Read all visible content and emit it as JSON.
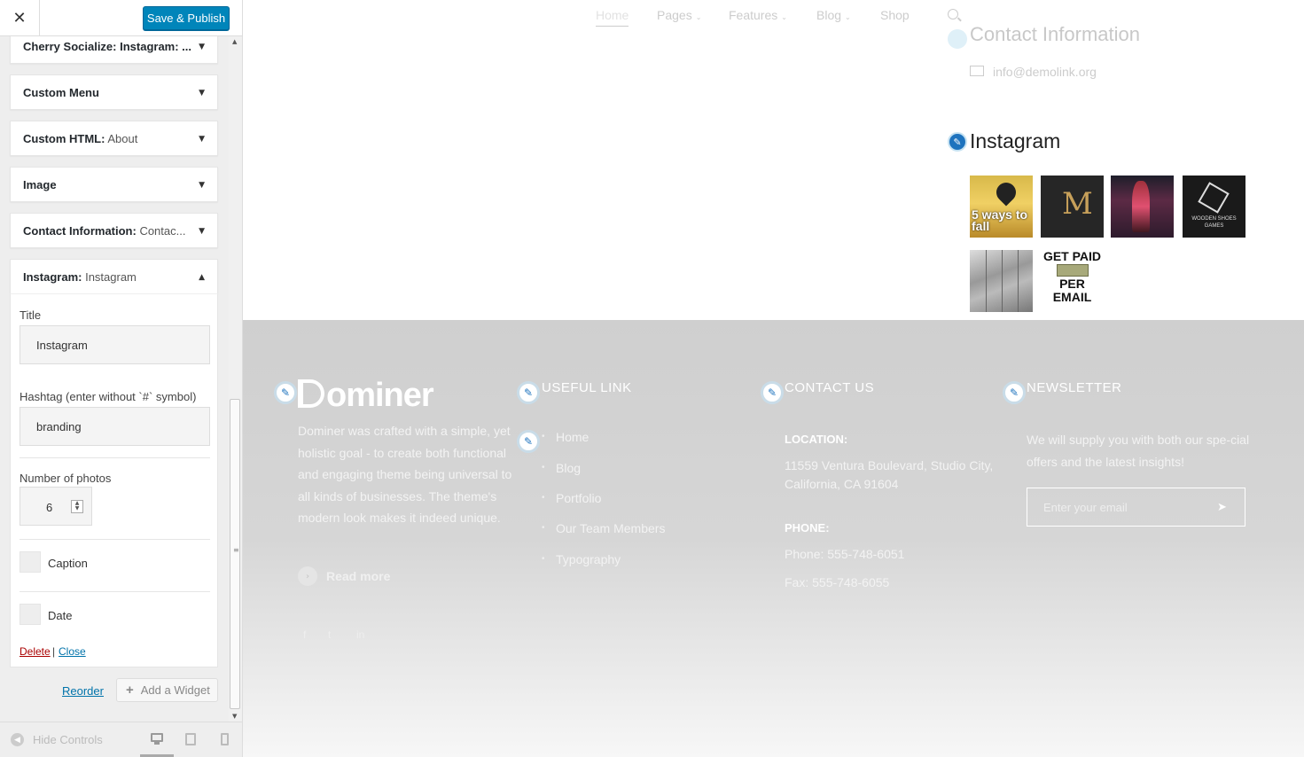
{
  "customizer": {
    "close_icon": "close-icon",
    "save_label": "Save & Publish",
    "widgets": [
      {
        "name": "Cherry Socialize: Instagram: ...",
        "sub": ""
      },
      {
        "name": "Custom Menu",
        "sub": ""
      },
      {
        "name": "Custom HTML:",
        "sub": " About"
      },
      {
        "name": "Image",
        "sub": ""
      },
      {
        "name": "Contact Information:",
        "sub": " Contac..."
      },
      {
        "name": "Instagram:",
        "sub": " Instagram"
      }
    ],
    "form": {
      "title_label": "Title",
      "title_value": "Instagram",
      "hashtag_label": "Hashtag (enter without `#` symbol)",
      "hashtag_value": "branding",
      "photos_label": "Number of photos",
      "photos_value": "6",
      "caption_label": "Caption",
      "date_label": "Date",
      "delete_label": "Delete",
      "separator": "|",
      "close_label": "Close"
    },
    "reorder_label": "Reorder",
    "add_widget_label": "Add a Widget",
    "hide_controls_label": "Hide Controls"
  },
  "preview": {
    "nav": {
      "home": "Home",
      "pages": "Pages",
      "features": "Features",
      "blog": "Blog",
      "shop": "Shop"
    },
    "contact_widget_title": "Contact Information",
    "contact_email": "info@demolink.org",
    "instagram_title": "Instagram",
    "photos": {
      "p1_text": "5 ways to fall",
      "p4_text": "WOODEN SHOES GAMES",
      "p6_top": "GET PAID",
      "p6_bottom": "PER EMAIL"
    },
    "footer": {
      "logo": "ominer",
      "about": "Dominer was crafted with a simple, yet holistic goal - to create both functional and engaging theme being universal to all kinds of businesses. The theme's modern look makes it indeed unique.",
      "read_more": "Read more",
      "useful_title": "USEFUL LINK",
      "links": [
        "Home",
        "Blog",
        "Portfolio",
        "Our Team Members",
        "Typography"
      ],
      "contact_title": "CONTACT US",
      "location_label": "LOCATION:",
      "location_value": "11559 Ventura Boulevard, Studio City, California, CA 91604",
      "phone_label": "PHONE:",
      "phone_value": "Phone: 555-748-6051",
      "fax_value": "Fax: 555-748-6055",
      "newsletter_title": "NEWSLETTER",
      "newsletter_text": "We will supply you with both our spe-cial offers and the latest insights!",
      "newsletter_placeholder": "Enter your email",
      "social": [
        "f",
        "t",
        "in"
      ],
      "copyright": "Copyright © 2017 All rights reserved by Dominer"
    }
  },
  "colors": {
    "primary_button": "#0085ba",
    "link": "#0073aa",
    "delete": "#a00",
    "accent": "#1e73be"
  }
}
